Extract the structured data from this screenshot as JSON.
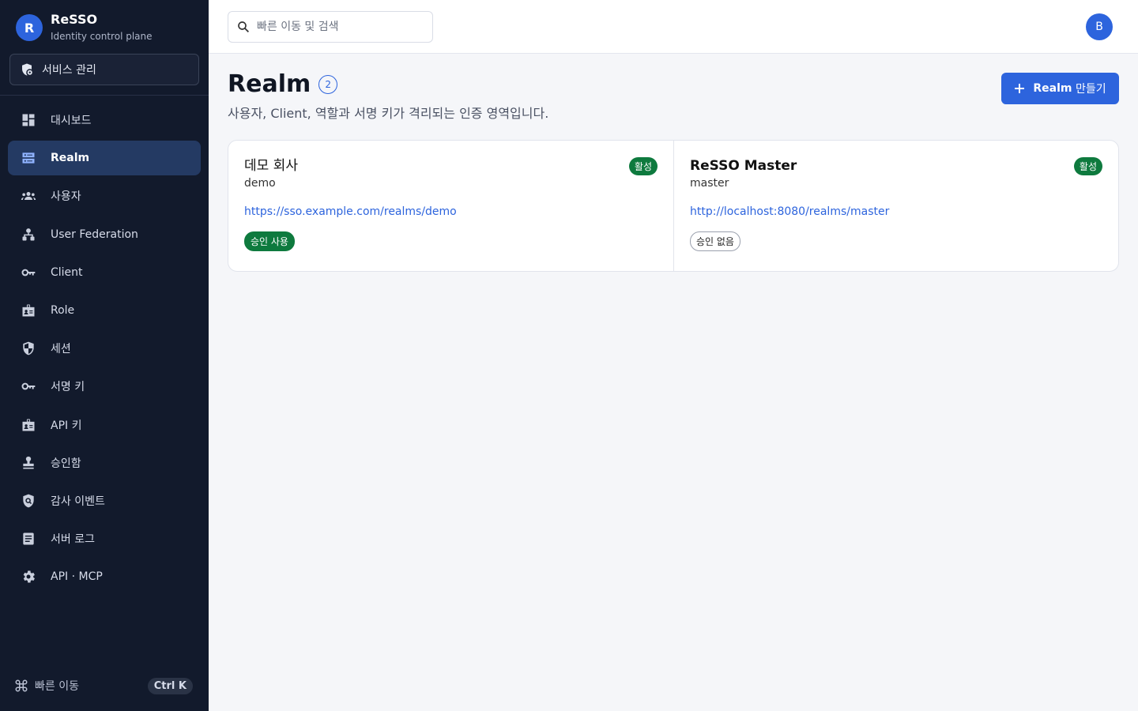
{
  "brand": {
    "logo_letter": "R",
    "name": "ReSSO",
    "subtitle": "Identity control plane"
  },
  "service_button": {
    "label": "서비스 관리",
    "icon": "shield-gear-icon"
  },
  "sidebar": {
    "items": [
      {
        "label": "대시보드",
        "icon": "dashboard-icon",
        "active": false
      },
      {
        "label": "Realm",
        "icon": "server-icon",
        "active": true
      },
      {
        "label": "사용자",
        "icon": "users-icon",
        "active": false
      },
      {
        "label": "User Federation",
        "icon": "hierarchy-icon",
        "active": false
      },
      {
        "label": "Client",
        "icon": "key-icon",
        "active": false
      },
      {
        "label": "Role",
        "icon": "badge-icon",
        "active": false
      },
      {
        "label": "세션",
        "icon": "shield-icon",
        "active": false
      },
      {
        "label": "서명 키",
        "icon": "key-icon",
        "active": false
      },
      {
        "label": "API 키",
        "icon": "badge-icon",
        "active": false
      },
      {
        "label": "승인함",
        "icon": "stamp-icon",
        "active": false
      },
      {
        "label": "감사 이벤트",
        "icon": "shield-search-icon",
        "active": false
      },
      {
        "label": "서버 로그",
        "icon": "document-icon",
        "active": false
      },
      {
        "label": "API · MCP",
        "icon": "gear-icon",
        "active": false
      }
    ],
    "quick_nav": {
      "label": "빠른 이동",
      "shortcut": "Ctrl K",
      "icon": "command-icon"
    }
  },
  "topbar": {
    "search_placeholder": "빠른 이동 및 검색",
    "avatar_letter": "B"
  },
  "page": {
    "title": "Realm",
    "count": "2",
    "subtitle": "사용자, Client, 역할과 서명 키가 격리되는 인증 영역입니다.",
    "create_button": {
      "bold": "Realm",
      "rest": " 만들기"
    }
  },
  "realms": [
    {
      "name": "데모 회사",
      "slug": "demo",
      "url": "https://sso.example.com/realms/demo",
      "status": "활성",
      "approval": "승인 사용"
    },
    {
      "name": "ReSSO Master",
      "slug": "master",
      "url": "http://localhost:8080/realms/master",
      "status": "활성",
      "approval": "승인 없음"
    }
  ],
  "colors": {
    "accent": "#2d64dd",
    "sidebar_bg": "#121a2c",
    "active_bg": "#243a63",
    "success": "#0e7a3e"
  }
}
